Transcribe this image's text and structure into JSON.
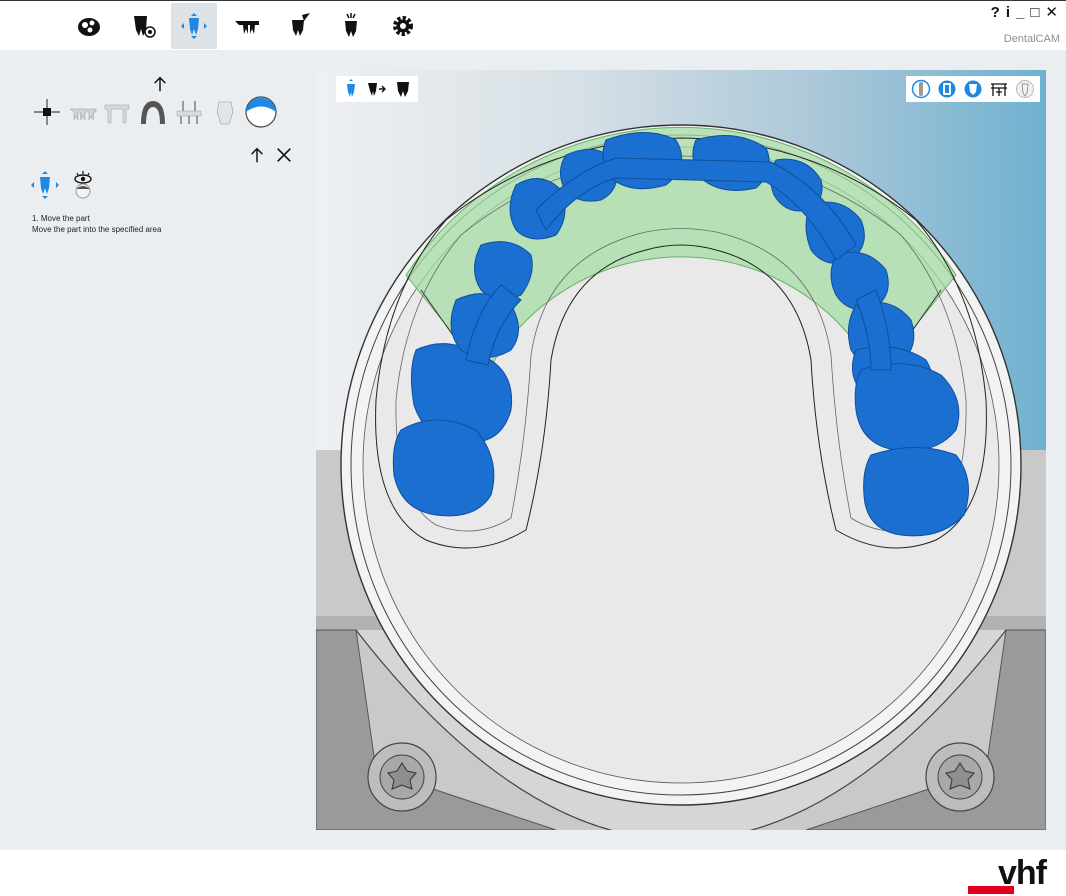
{
  "window": {
    "title": "DentalCAM",
    "help": "?",
    "info": "i",
    "minimize": "_",
    "maximize": "□",
    "close": "✕"
  },
  "nav": [
    {
      "icon": "blank-disc-icon",
      "active": false
    },
    {
      "icon": "tooth-job-icon",
      "active": false
    },
    {
      "icon": "move-tooth-icon",
      "active": true
    },
    {
      "icon": "tooth-bridge-icon",
      "active": false
    },
    {
      "icon": "tooth-calculate-icon",
      "active": false
    },
    {
      "icon": "tooth-milling-icon",
      "active": false
    },
    {
      "icon": "settings-gear-icon",
      "active": false
    }
  ],
  "tools": [
    {
      "icon": "position-axis-icon"
    },
    {
      "icon": "bridge-multi-icon"
    },
    {
      "icon": "bridge-frame-icon"
    },
    {
      "icon": "full-arch-icon"
    },
    {
      "icon": "implant-bar-icon"
    },
    {
      "icon": "abutment-icon"
    },
    {
      "icon": "disc-segment-icon"
    }
  ],
  "step": {
    "title": "1. Move the part",
    "description": "Move the part into the specified area"
  },
  "colors": {
    "accent": "#1e88e5",
    "tooth": "#1a6fd0",
    "zone": "#8fd49a",
    "logo_red": "#e2001a"
  },
  "footer": {
    "logo_text": "vhf"
  }
}
